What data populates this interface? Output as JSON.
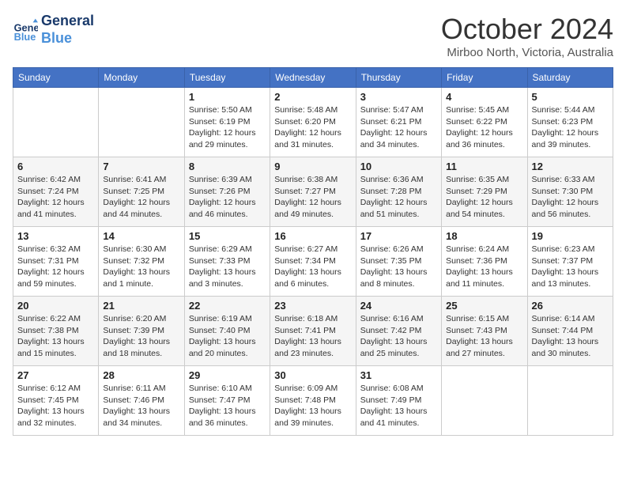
{
  "header": {
    "logo_line1": "General",
    "logo_line2": "Blue",
    "month_title": "October 2024",
    "location": "Mirboo North, Victoria, Australia"
  },
  "days_of_week": [
    "Sunday",
    "Monday",
    "Tuesday",
    "Wednesday",
    "Thursday",
    "Friday",
    "Saturday"
  ],
  "weeks": [
    [
      {
        "day": "",
        "info": ""
      },
      {
        "day": "",
        "info": ""
      },
      {
        "day": "1",
        "info": "Sunrise: 5:50 AM\nSunset: 6:19 PM\nDaylight: 12 hours\nand 29 minutes."
      },
      {
        "day": "2",
        "info": "Sunrise: 5:48 AM\nSunset: 6:20 PM\nDaylight: 12 hours\nand 31 minutes."
      },
      {
        "day": "3",
        "info": "Sunrise: 5:47 AM\nSunset: 6:21 PM\nDaylight: 12 hours\nand 34 minutes."
      },
      {
        "day": "4",
        "info": "Sunrise: 5:45 AM\nSunset: 6:22 PM\nDaylight: 12 hours\nand 36 minutes."
      },
      {
        "day": "5",
        "info": "Sunrise: 5:44 AM\nSunset: 6:23 PM\nDaylight: 12 hours\nand 39 minutes."
      }
    ],
    [
      {
        "day": "6",
        "info": "Sunrise: 6:42 AM\nSunset: 7:24 PM\nDaylight: 12 hours\nand 41 minutes."
      },
      {
        "day": "7",
        "info": "Sunrise: 6:41 AM\nSunset: 7:25 PM\nDaylight: 12 hours\nand 44 minutes."
      },
      {
        "day": "8",
        "info": "Sunrise: 6:39 AM\nSunset: 7:26 PM\nDaylight: 12 hours\nand 46 minutes."
      },
      {
        "day": "9",
        "info": "Sunrise: 6:38 AM\nSunset: 7:27 PM\nDaylight: 12 hours\nand 49 minutes."
      },
      {
        "day": "10",
        "info": "Sunrise: 6:36 AM\nSunset: 7:28 PM\nDaylight: 12 hours\nand 51 minutes."
      },
      {
        "day": "11",
        "info": "Sunrise: 6:35 AM\nSunset: 7:29 PM\nDaylight: 12 hours\nand 54 minutes."
      },
      {
        "day": "12",
        "info": "Sunrise: 6:33 AM\nSunset: 7:30 PM\nDaylight: 12 hours\nand 56 minutes."
      }
    ],
    [
      {
        "day": "13",
        "info": "Sunrise: 6:32 AM\nSunset: 7:31 PM\nDaylight: 12 hours\nand 59 minutes."
      },
      {
        "day": "14",
        "info": "Sunrise: 6:30 AM\nSunset: 7:32 PM\nDaylight: 13 hours\nand 1 minute."
      },
      {
        "day": "15",
        "info": "Sunrise: 6:29 AM\nSunset: 7:33 PM\nDaylight: 13 hours\nand 3 minutes."
      },
      {
        "day": "16",
        "info": "Sunrise: 6:27 AM\nSunset: 7:34 PM\nDaylight: 13 hours\nand 6 minutes."
      },
      {
        "day": "17",
        "info": "Sunrise: 6:26 AM\nSunset: 7:35 PM\nDaylight: 13 hours\nand 8 minutes."
      },
      {
        "day": "18",
        "info": "Sunrise: 6:24 AM\nSunset: 7:36 PM\nDaylight: 13 hours\nand 11 minutes."
      },
      {
        "day": "19",
        "info": "Sunrise: 6:23 AM\nSunset: 7:37 PM\nDaylight: 13 hours\nand 13 minutes."
      }
    ],
    [
      {
        "day": "20",
        "info": "Sunrise: 6:22 AM\nSunset: 7:38 PM\nDaylight: 13 hours\nand 15 minutes."
      },
      {
        "day": "21",
        "info": "Sunrise: 6:20 AM\nSunset: 7:39 PM\nDaylight: 13 hours\nand 18 minutes."
      },
      {
        "day": "22",
        "info": "Sunrise: 6:19 AM\nSunset: 7:40 PM\nDaylight: 13 hours\nand 20 minutes."
      },
      {
        "day": "23",
        "info": "Sunrise: 6:18 AM\nSunset: 7:41 PM\nDaylight: 13 hours\nand 23 minutes."
      },
      {
        "day": "24",
        "info": "Sunrise: 6:16 AM\nSunset: 7:42 PM\nDaylight: 13 hours\nand 25 minutes."
      },
      {
        "day": "25",
        "info": "Sunrise: 6:15 AM\nSunset: 7:43 PM\nDaylight: 13 hours\nand 27 minutes."
      },
      {
        "day": "26",
        "info": "Sunrise: 6:14 AM\nSunset: 7:44 PM\nDaylight: 13 hours\nand 30 minutes."
      }
    ],
    [
      {
        "day": "27",
        "info": "Sunrise: 6:12 AM\nSunset: 7:45 PM\nDaylight: 13 hours\nand 32 minutes."
      },
      {
        "day": "28",
        "info": "Sunrise: 6:11 AM\nSunset: 7:46 PM\nDaylight: 13 hours\nand 34 minutes."
      },
      {
        "day": "29",
        "info": "Sunrise: 6:10 AM\nSunset: 7:47 PM\nDaylight: 13 hours\nand 36 minutes."
      },
      {
        "day": "30",
        "info": "Sunrise: 6:09 AM\nSunset: 7:48 PM\nDaylight: 13 hours\nand 39 minutes."
      },
      {
        "day": "31",
        "info": "Sunrise: 6:08 AM\nSunset: 7:49 PM\nDaylight: 13 hours\nand 41 minutes."
      },
      {
        "day": "",
        "info": ""
      },
      {
        "day": "",
        "info": ""
      }
    ]
  ]
}
